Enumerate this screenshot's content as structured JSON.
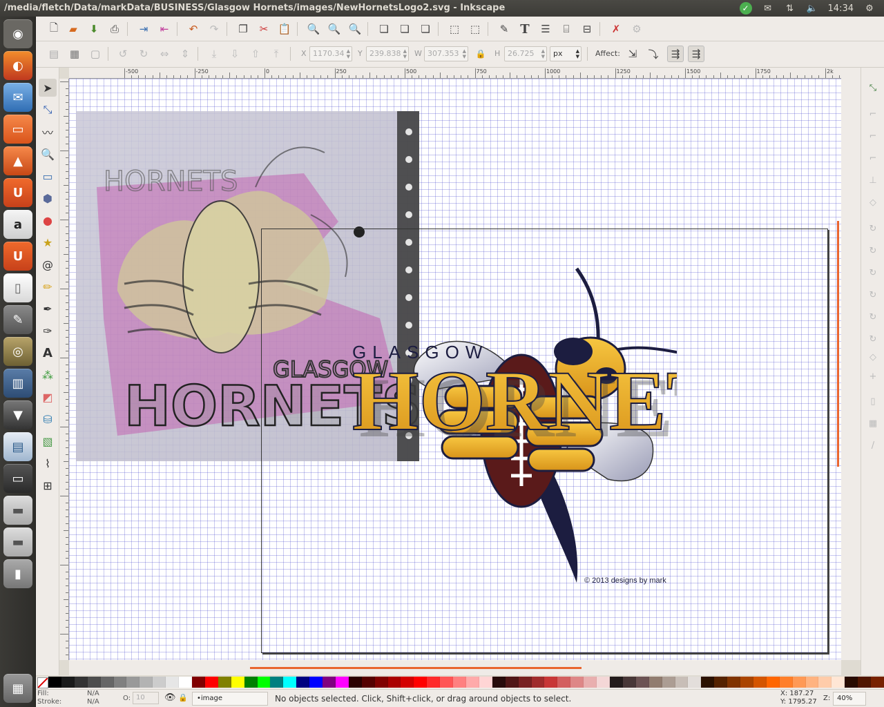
{
  "window": {
    "title": "/media/fletch/Data/markData/BUSINESS/Glasgow Hornets/images/NewHornetsLogo2.svg - Inkscape"
  },
  "top_panel": {
    "clock": "14:34",
    "icons": [
      "checkmark-icon",
      "mail-icon",
      "network-icon",
      "volume-icon"
    ]
  },
  "launcher": {
    "items": [
      "dash-home",
      "firefox",
      "thunderbird",
      "files",
      "software-center",
      "ubuntu-one",
      "amazon",
      "ubuntu-one-music",
      "libreoffice",
      "system-settings",
      "camera",
      "books",
      "inkscape",
      "image-viewer",
      "terminal",
      "drive",
      "drive-2",
      "usb",
      "trash"
    ]
  },
  "control_bar": {
    "x_label": "X",
    "x_value": "1170.34",
    "y_label": "Y",
    "y_value": "239.838",
    "w_label": "W",
    "w_value": "307.353",
    "h_label": "H",
    "h_value": "26.725",
    "unit": "px",
    "affect_label": "Affect:"
  },
  "ruler": {
    "labels": [
      "-500",
      "-250",
      "0",
      "250",
      "500",
      "750",
      "1000",
      "1250",
      "1500",
      "1750",
      "2k"
    ]
  },
  "canvas": {
    "logo_top_text": "GLASGOW",
    "logo_main_text": "HORNETS",
    "logo_copyright": "© 2013 designs by mark",
    "sketch_label_1": "GLASGOW",
    "sketch_label_2": "HORNETS",
    "sketch_label_3": "HORNETS"
  },
  "status": {
    "fill_label": "Fill:",
    "fill_value": "N/A",
    "stroke_label": "Stroke:",
    "stroke_value": "N/A",
    "opacity_label": "O:",
    "opacity_value": "10",
    "layer": "•image",
    "message": "No objects selected. Click, Shift+click, or drag around objects to select.",
    "x_coord": "X:  187.27",
    "y_coord": "Y: 1795.27",
    "zoom_label": "Z:",
    "zoom_value": "40%"
  },
  "palette_colors": [
    "#000000",
    "#1a1a1a",
    "#333333",
    "#4d4d4d",
    "#666666",
    "#808080",
    "#999999",
    "#b3b3b3",
    "#cccccc",
    "#e6e6e6",
    "#ffffff",
    "#800000",
    "#ff0000",
    "#808000",
    "#ffff00",
    "#008000",
    "#00ff00",
    "#008080",
    "#00ffff",
    "#000080",
    "#0000ff",
    "#800080",
    "#ff00ff",
    "#2b0000",
    "#550000",
    "#800000",
    "#aa0000",
    "#d40000",
    "#ff0000",
    "#ff2a2a",
    "#ff5555",
    "#ff8080",
    "#ffaaaa",
    "#ffd5d5",
    "#280b0b",
    "#501616",
    "#782121",
    "#a02c2c",
    "#c83737",
    "#d35f5f",
    "#de8787",
    "#e9afaf",
    "#f4d7d7",
    "#241c1c",
    "#483737",
    "#6c5353",
    "#917c6f",
    "#ac9d93",
    "#c8beb7",
    "#e3dedb",
    "#2b1100",
    "#552200",
    "#803300",
    "#aa4400",
    "#d45500",
    "#ff6600",
    "#ff7f2a",
    "#ff9955",
    "#ffb380",
    "#ffccaa",
    "#ffe6d5",
    "#280b00",
    "#501600",
    "#782100"
  ]
}
